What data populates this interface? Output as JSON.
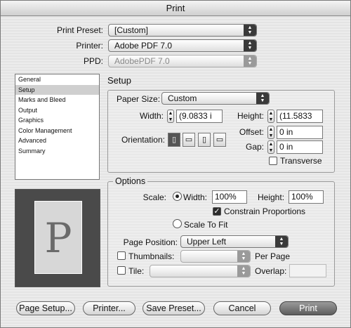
{
  "window": {
    "title": "Print"
  },
  "top": {
    "preset_label": "Print Preset:",
    "preset_value": "[Custom]",
    "printer_label": "Printer:",
    "printer_value": "Adobe PDF 7.0",
    "ppd_label": "PPD:",
    "ppd_value": "AdobePDF 7.0"
  },
  "sidebar": {
    "items": [
      {
        "label": "General"
      },
      {
        "label": "Setup"
      },
      {
        "label": "Marks and Bleed"
      },
      {
        "label": "Output"
      },
      {
        "label": "Graphics"
      },
      {
        "label": "Color Management"
      },
      {
        "label": "Advanced"
      },
      {
        "label": "Summary"
      }
    ],
    "selected_index": 1
  },
  "preview": {
    "glyph": "P"
  },
  "setup": {
    "title": "Setup",
    "paper": {
      "title": "Paper Size:",
      "value": "Custom",
      "width_label": "Width:",
      "width_value": "(9.0833 i",
      "height_label": "Height:",
      "height_value": "(11.5833",
      "orientation_label": "Orientation:",
      "orientation_icons": [
        "portrait-icon",
        "landscape-icon",
        "reverse-portrait-icon",
        "reverse-landscape-icon"
      ],
      "offset_label": "Offset:",
      "offset_value": "0 in",
      "gap_label": "Gap:",
      "gap_value": "0 in",
      "transverse_label": "Transverse",
      "transverse_checked": false
    },
    "options": {
      "title": "Options",
      "scale_label": "Scale:",
      "width_label": "Width:",
      "width_value": "100%",
      "height_label": "Height:",
      "height_value": "100%",
      "constrain_label": "Constrain Proportions",
      "constrain_checked": true,
      "fit_label": "Scale To Fit",
      "page_position_label": "Page Position:",
      "page_position_value": "Upper Left",
      "thumbnails_label": "Thumbnails:",
      "thumbnails_value": "",
      "per_page_label": "Per Page",
      "tile_label": "Tile:",
      "tile_value": "",
      "overlap_label": "Overlap:",
      "overlap_value": ""
    }
  },
  "buttons": {
    "page_setup": "Page Setup...",
    "printer": "Printer...",
    "save_preset": "Save Preset...",
    "cancel": "Cancel",
    "print": "Print"
  }
}
